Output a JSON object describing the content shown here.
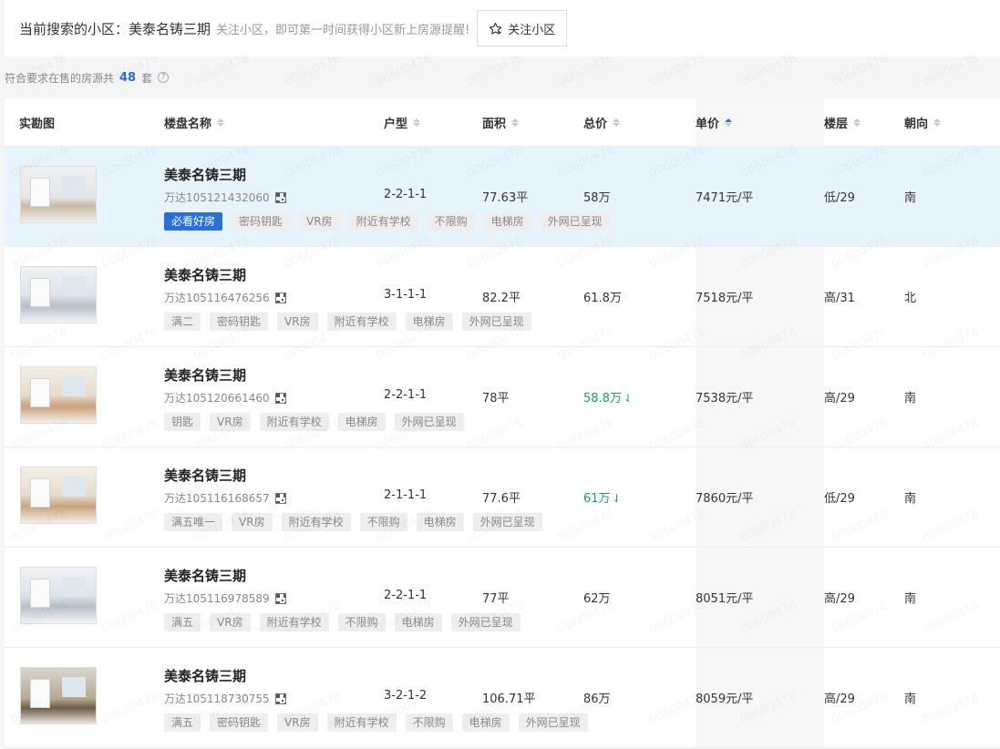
{
  "header": {
    "label": "当前搜索的小区：",
    "community": "美泰名铸三期",
    "hint": "关注小区，即可第一时间获得小区新上房源提醒!",
    "follow_label": "关注小区"
  },
  "summary": {
    "prefix": "符合要求在售的房源共",
    "count": "48",
    "suffix": "套",
    "help_icon": "?"
  },
  "columns": {
    "photo": "实勘图",
    "name": "楼盘名称",
    "layout": "户型",
    "area": "面积",
    "total": "总价",
    "unit": "单价",
    "floor": "楼层",
    "orient": "朝向"
  },
  "sort": {
    "active_column": "单价",
    "direction": "ascending"
  },
  "colors": {
    "accent": "#2a6ed8",
    "price_down": "#1aa05a",
    "highlight_row": "#e6f4fd"
  },
  "listings": [
    {
      "name": "美泰名铸三期",
      "code": "万达105121432060",
      "tags": [
        "必看好房",
        "密码钥匙",
        "VR房",
        "附近有学校",
        "不限购",
        "电梯房",
        "外网已呈现"
      ],
      "layout": "2-2-1-1",
      "area": "77.63平",
      "total": "58万",
      "price_down": false,
      "unit": "7471元/平",
      "floor": "低/29",
      "orient": "南"
    },
    {
      "name": "美泰名铸三期",
      "code": "万达105116476256",
      "tags": [
        "满二",
        "密码钥匙",
        "VR房",
        "附近有学校",
        "电梯房",
        "外网已呈现"
      ],
      "layout": "3-1-1-1",
      "area": "82.2平",
      "total": "61.8万",
      "price_down": false,
      "unit": "7518元/平",
      "floor": "高/31",
      "orient": "北"
    },
    {
      "name": "美泰名铸三期",
      "code": "万达105120661460",
      "tags": [
        "钥匙",
        "VR房",
        "附近有学校",
        "电梯房",
        "外网已呈现"
      ],
      "layout": "2-2-1-1",
      "area": "78平",
      "total": "58.8万",
      "price_down": true,
      "unit": "7538元/平",
      "floor": "高/29",
      "orient": "南"
    },
    {
      "name": "美泰名铸三期",
      "code": "万达105116168657",
      "tags": [
        "满五唯一",
        "VR房",
        "附近有学校",
        "不限购",
        "电梯房",
        "外网已呈现"
      ],
      "layout": "2-1-1-1",
      "area": "77.6平",
      "total": "61万",
      "price_down": true,
      "unit": "7860元/平",
      "floor": "低/29",
      "orient": "南"
    },
    {
      "name": "美泰名铸三期",
      "code": "万达105116978589",
      "tags": [
        "满五",
        "VR房",
        "附近有学校",
        "不限购",
        "电梯房",
        "外网已呈现"
      ],
      "layout": "2-2-1-1",
      "area": "77平",
      "total": "62万",
      "price_down": false,
      "unit": "8051元/平",
      "floor": "高/29",
      "orient": "南"
    },
    {
      "name": "美泰名铸三期",
      "code": "万达105118730755",
      "tags": [
        "满五",
        "密码钥匙",
        "VR房",
        "附近有学校",
        "不限购",
        "电梯房",
        "外网已呈现"
      ],
      "layout": "3-2-1-2",
      "area": "106.71平",
      "total": "86万",
      "price_down": false,
      "unit": "8059元/平",
      "floor": "高/29",
      "orient": "南"
    }
  ],
  "watermark_text": "00600478"
}
